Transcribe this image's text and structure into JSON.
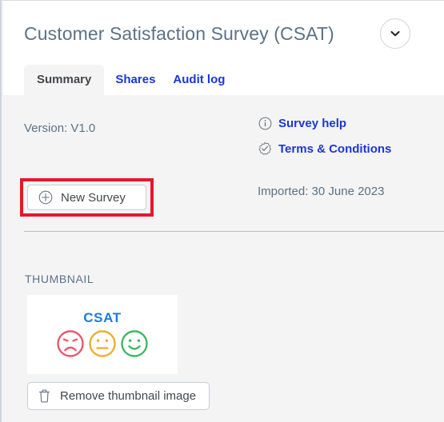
{
  "header": {
    "title": "Customer Satisfaction Survey (CSAT)",
    "expand_icon": "chevron-down-icon"
  },
  "tabs": [
    {
      "label": "Summary",
      "active": true
    },
    {
      "label": "Shares",
      "active": false
    },
    {
      "label": "Audit log",
      "active": false
    }
  ],
  "summary": {
    "version_text": "Version: V1.0",
    "new_survey_label": "New Survey",
    "new_survey_icon": "plus-circle-icon",
    "imported_text": "Imported: 30 June 2023",
    "links": [
      {
        "label": "Survey help",
        "icon": "info-circle-icon"
      },
      {
        "label": "Terms & Conditions",
        "icon": "certificate-check-icon"
      }
    ]
  },
  "thumbnail": {
    "section_label": "THUMBNAIL",
    "image_caption": "CSAT",
    "faces": [
      {
        "name": "sad-face",
        "color": "#e8596a"
      },
      {
        "name": "neutral-face",
        "color": "#f0ad2e"
      },
      {
        "name": "happy-face",
        "color": "#3cb964"
      }
    ],
    "remove_label": "Remove thumbnail image",
    "remove_icon": "trash-icon"
  },
  "colors": {
    "link_blue": "#1a37d8",
    "title_slate": "#5b7287",
    "highlight_red": "#e8162a",
    "csat_blue": "#1a7ce0",
    "page_bg": "#f4f4f4"
  }
}
